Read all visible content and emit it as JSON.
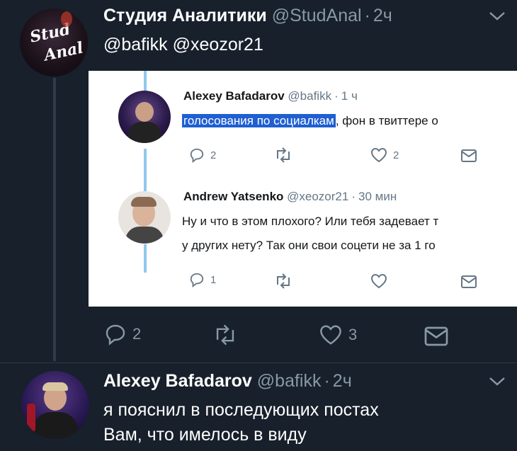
{
  "tweet1": {
    "display_name": "Студия Аналитики",
    "handle": "@StudAnal",
    "separator": "·",
    "time": "2ч",
    "mentions": "@bafikk @xeozor21",
    "avatar_text_line1": "Stud",
    "avatar_text_line2": "Anal",
    "actions": {
      "reply_count": "2",
      "retweet_count": "",
      "like_count": "3"
    }
  },
  "embedded": {
    "reply1": {
      "display_name": "Alexey Bafadarov",
      "handle": "@bafikk",
      "separator": "·",
      "time": "1 ч",
      "text_highlighted": "голосования по социалкам",
      "text_rest": ", фон в твиттере о",
      "actions": {
        "reply_count": "2",
        "like_count": "2"
      }
    },
    "reply2": {
      "display_name": "Andrew Yatsenko",
      "handle": "@xeozor21",
      "separator": "·",
      "time": "30 мин",
      "line1": "Ну и что в этом плохого? Или тебя задевает т",
      "line2": "у других нету? Так они свои соцети не за 1 го",
      "actions": {
        "reply_count": "1"
      }
    }
  },
  "tweet2": {
    "display_name": "Alexey Bafadarov",
    "handle": "@bafikk",
    "separator": "·",
    "time": "2ч",
    "line1": "я пояснил в последующих постах",
    "line2": "Вам, что имелось в виду"
  },
  "colors": {
    "background": "#17202b",
    "accent": "#1da1f2",
    "muted": "#8899a6",
    "highlight": "#1f5fd1"
  }
}
